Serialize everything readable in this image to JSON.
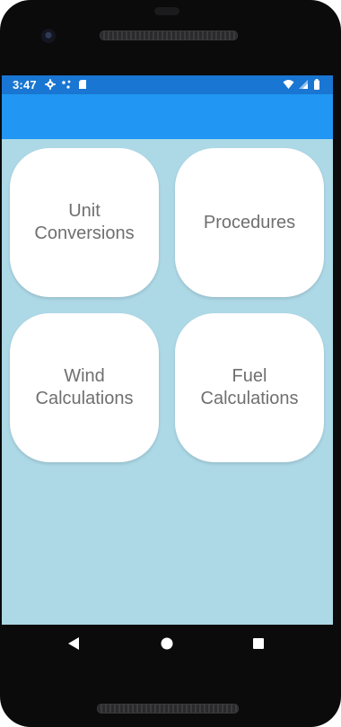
{
  "status_bar": {
    "time": "3:47",
    "left_icons": [
      "settings-gear-icon",
      "sync-dots-icon",
      "sd-card-icon"
    ],
    "right_icons": [
      "wifi-icon",
      "cell-signal-icon",
      "battery-icon"
    ],
    "bg_color": "#1976d2"
  },
  "app_bar": {
    "title": "",
    "bg_color": "#2196f3"
  },
  "screen": {
    "bg_color": "#add8e6"
  },
  "tiles": [
    {
      "label": "Unit\nConversions"
    },
    {
      "label": "Procedures"
    },
    {
      "label": "Wind\nCalculations"
    },
    {
      "label": "Fuel\nCalculations"
    }
  ],
  "nav": {
    "back": "back-triangle-icon",
    "home": "home-circle-icon",
    "recent": "recents-square-icon"
  }
}
